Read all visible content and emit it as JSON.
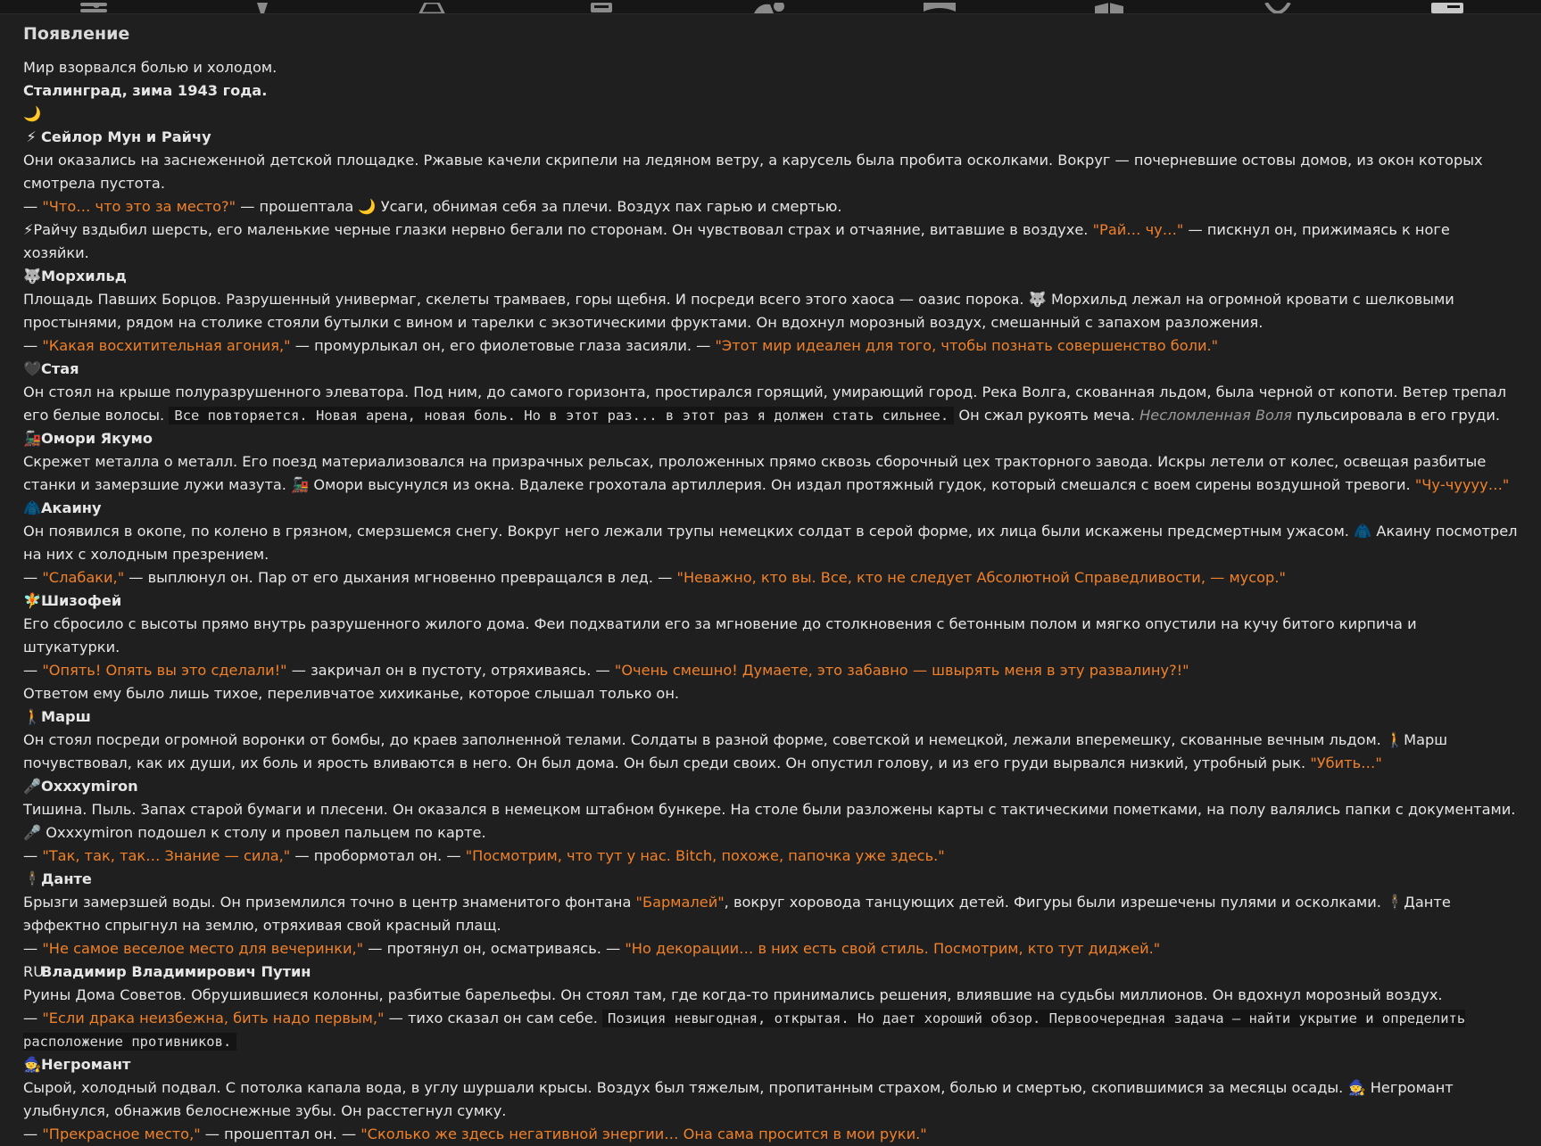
{
  "topbar": {
    "tabs": [
      {
        "icon": "sliders-icon"
      },
      {
        "icon": "pin-icon"
      },
      {
        "icon": "font-icon"
      },
      {
        "icon": "book-icon"
      },
      {
        "icon": "user-gear-icon"
      },
      {
        "icon": "avatar-frame-icon"
      },
      {
        "icon": "cube-icon"
      },
      {
        "icon": "smile-icon"
      },
      {
        "icon": "id-card-icon"
      }
    ]
  },
  "section_title": "Появление",
  "lines": [
    {
      "type": "text",
      "parts": [
        {
          "t": "Мир взорвался болью и холодом."
        }
      ]
    },
    {
      "type": "text",
      "parts": [
        {
          "t": "Сталинград, зима 1943 года.",
          "s": "bold"
        }
      ]
    },
    {
      "type": "header",
      "parts": [
        {
          "t": "🌙⚡",
          "s": "icon"
        },
        {
          "t": "Сейлор Мун и Райчу",
          "s": "name"
        }
      ]
    },
    {
      "type": "text",
      "parts": [
        {
          "t": "Они оказались на заснеженной детской площадке. Ржавые качели скрипели на ледяном ветру, а карусель была пробита осколками. Вокруг — почерневшие остовы домов, из окон которых смотрела пустота."
        }
      ]
    },
    {
      "type": "text",
      "parts": [
        {
          "t": "— "
        },
        {
          "t": "\"Что… что это за место?\"",
          "s": "q"
        },
        {
          "t": " — прошептала 🌙 Усаги, обнимая себя за плечи. Воздух пах гарью и смертью."
        }
      ]
    },
    {
      "type": "text",
      "parts": [
        {
          "t": "⚡Райчу вздыбил шерсть, его маленькие черные глазки нервно бегали по сторонам. Он чувствовал страх и отчаяние, витавшие в воздухе. "
        },
        {
          "t": "\"Рай… чу…\"",
          "s": "q"
        },
        {
          "t": " — пискнул он, прижимаясь к ноге хозяйки."
        }
      ]
    },
    {
      "type": "header",
      "parts": [
        {
          "t": "🐺",
          "s": "icon"
        },
        {
          "t": "Морхильд",
          "s": "name"
        }
      ]
    },
    {
      "type": "text",
      "parts": [
        {
          "t": "Площадь Павших Борцов. Разрушенный универмаг, скелеты трамваев, горы щебня. И посреди всего этого хаоса — оазис порока. 🐺 Морхильд лежал на огромной кровати с шелковыми простынями, рядом на столике стояли бутылки с вином и тарелки с экзотическими фруктами. Он вдохнул морозный воздух, смешанный с запахом разложения."
        }
      ]
    },
    {
      "type": "text",
      "parts": [
        {
          "t": "— "
        },
        {
          "t": "\"Какая восхитительная агония,\"",
          "s": "q"
        },
        {
          "t": " — промурлыкал он, его фиолетовые глаза засияли. — "
        },
        {
          "t": "\"Этот мир идеален для того, чтобы познать совершенство боли.\"",
          "s": "q"
        }
      ]
    },
    {
      "type": "header",
      "parts": [
        {
          "t": "🖤",
          "s": "icon"
        },
        {
          "t": "Стая",
          "s": "name"
        }
      ]
    },
    {
      "type": "text",
      "parts": [
        {
          "t": "Он стоял на крыше полуразрушенного элеватора. Под ним, до самого горизонта, простирался горящий, умирающий город. Река Волга, скованная льдом, была черной от копоти. Ветер трепал его белые волосы. "
        },
        {
          "t": "Все повторяется. Новая арена, новая боль. Но в этот раз... в этот раз я должен стать сильнее.",
          "s": "code"
        },
        {
          "t": " Он сжал рукоять меча. "
        },
        {
          "t": "Несломленная Воля",
          "s": "em"
        },
        {
          "t": " пульсировала в его груди."
        }
      ]
    },
    {
      "type": "header",
      "parts": [
        {
          "t": "🚂",
          "s": "icon"
        },
        {
          "t": "Омори Якумо",
          "s": "name"
        }
      ]
    },
    {
      "type": "text",
      "parts": [
        {
          "t": "Скрежет металла о металл. Его поезд материализовался на призрачных рельсах, проложенных прямо сквозь сборочный цех тракторного завода. Искры летели от колес, освещая разбитые станки и замерзшие лужи мазута. 🚂 Омори высунулся из окна. Вдалеке грохотала артиллерия. Он издал протяжный гудок, который смешался с воем сирены воздушной тревоги. "
        },
        {
          "t": "\"Чу-чуууу…\"",
          "s": "q"
        }
      ]
    },
    {
      "type": "header",
      "parts": [
        {
          "t": "🧥",
          "s": "icon"
        },
        {
          "t": "Акаину",
          "s": "name"
        }
      ]
    },
    {
      "type": "text",
      "parts": [
        {
          "t": "Он появился в окопе, по колено в грязном, смерзшемся снегу. Вокруг него лежали трупы немецких солдат в серой форме, их лица были искажены предсмертным ужасом. 🧥 Акаину посмотрел на них с холодным презрением."
        }
      ]
    },
    {
      "type": "text",
      "parts": [
        {
          "t": "— "
        },
        {
          "t": "\"Слабаки,\"",
          "s": "q"
        },
        {
          "t": " — выплюнул он. Пар от его дыхания мгновенно превращался в лед. — "
        },
        {
          "t": "\"Неважно, кто вы. Все, кто не следует Абсолютной Справедливости, — мусор.\"",
          "s": "q"
        }
      ]
    },
    {
      "type": "header",
      "parts": [
        {
          "t": "🧚",
          "s": "icon"
        },
        {
          "t": "Шизофей",
          "s": "name"
        }
      ]
    },
    {
      "type": "text",
      "parts": [
        {
          "t": "Его сбросило с высоты прямо внутрь разрушенного жилого дома. Феи подхватили его за мгновение до столкновения с бетонным полом и мягко опустили на кучу битого кирпича и штукатурки."
        }
      ]
    },
    {
      "type": "text",
      "parts": [
        {
          "t": "— "
        },
        {
          "t": "\"Опять! Опять вы это сделали!\"",
          "s": "q"
        },
        {
          "t": " — закричал он в пустоту, отряхиваясь. — "
        },
        {
          "t": "\"Очень смешно! Думаете, это забавно — швырять меня в эту развалину?!\"",
          "s": "q"
        }
      ]
    },
    {
      "type": "text",
      "parts": [
        {
          "t": "Ответом ему было лишь тихое, переливчатое хихиканье, которое слышал только он."
        }
      ]
    },
    {
      "type": "header",
      "parts": [
        {
          "t": "🚶",
          "s": "icon"
        },
        {
          "t": "Марш",
          "s": "name"
        }
      ]
    },
    {
      "type": "text",
      "parts": [
        {
          "t": "Он стоял посреди огромной воронки от бомбы, до краев заполненной телами. Солдаты в разной форме, советской и немецкой, лежали вперемешку, скованные вечным льдом. 🚶Марш почувствовал, как их души, их боль и ярость вливаются в него. Он был дома. Он был среди своих. Он опустил голову, и из его груди вырвался низкий, утробный рык. "
        },
        {
          "t": "\"Убить…\"",
          "s": "q"
        }
      ]
    },
    {
      "type": "header",
      "parts": [
        {
          "t": "🎤",
          "s": "icon"
        },
        {
          "t": "Oxxxymiron",
          "s": "name"
        }
      ]
    },
    {
      "type": "text",
      "parts": [
        {
          "t": "Тишина. Пыль. Запах старой бумаги и плесени. Он оказался в немецком штабном бункере. На столе были разложены карты с тактическими пометками, на полу валялись папки с документами. 🎤 Oxxxymiron подошел к столу и провел пальцем по карте."
        }
      ]
    },
    {
      "type": "text",
      "parts": [
        {
          "t": "— "
        },
        {
          "t": "\"Так, так, так… Знание — сила,\"",
          "s": "q"
        },
        {
          "t": " — пробормотал он. — "
        },
        {
          "t": "\"Посмотрим, что тут у нас. Bitch, похоже, папочка уже здесь.\"",
          "s": "q"
        }
      ]
    },
    {
      "type": "header",
      "parts": [
        {
          "t": "🕴",
          "s": "icon"
        },
        {
          "t": "Данте",
          "s": "name"
        }
      ]
    },
    {
      "type": "text",
      "parts": [
        {
          "t": "Брызги замерзшей воды. Он приземлился точно в центр знаменитого фонтана "
        },
        {
          "t": "\"Бармалей\"",
          "s": "q"
        },
        {
          "t": ", вокруг хоровода танцующих детей. Фигуры были изрешечены пулями и осколками. 🕴Данте эффектно спрыгнул на землю, отряхивая свой красный плащ."
        }
      ]
    },
    {
      "type": "text",
      "parts": [
        {
          "t": "— "
        },
        {
          "t": "\"Не самое веселое место для вечеринки,\"",
          "s": "q"
        },
        {
          "t": " — протянул он, осматриваясь. — "
        },
        {
          "t": "\"Но декорации… в них есть свой стиль. Посмотрим, кто тут диджей.\"",
          "s": "q"
        }
      ]
    },
    {
      "type": "header",
      "parts": [
        {
          "t": "RU",
          "s": "icon"
        },
        {
          "t": "Владимир Владимирович Путин",
          "s": "name"
        }
      ]
    },
    {
      "type": "text",
      "parts": [
        {
          "t": "Руины Дома Советов. Обрушившиеся колонны, разбитые барельефы. Он стоял там, где когда-то принимались решения, влиявшие на судьбы миллионов. Он вдохнул морозный воздух."
        }
      ]
    },
    {
      "type": "text",
      "parts": [
        {
          "t": "— "
        },
        {
          "t": "\"Если драка неизбежна, бить надо первым,\"",
          "s": "q"
        },
        {
          "t": " — тихо сказал он сам себе. "
        },
        {
          "t": "Позиция невыгодная, открытая. Но дает хороший обзор. Первоочередная задача — найти укрытие и определить расположение противников.",
          "s": "code"
        }
      ]
    },
    {
      "type": "header",
      "parts": [
        {
          "t": "🧙",
          "s": "icon"
        },
        {
          "t": "Негромант",
          "s": "name"
        }
      ]
    },
    {
      "type": "text",
      "parts": [
        {
          "t": "Сырой, холодный подвал. С потолка капала вода, в углу шуршали крысы. Воздух был тяжелым, пропитанным страхом, болью и смертью, скопившимися за месяцы осады. 🧙 Негромант улыбнулся, обнажив белоснежные зубы. Он расстегнул сумку."
        }
      ]
    },
    {
      "type": "text",
      "parts": [
        {
          "t": "— "
        },
        {
          "t": "\"Прекрасное место,\"",
          "s": "q"
        },
        {
          "t": " — прошептал он. — "
        },
        {
          "t": "\"Сколько же здесь негативной энергии… Она сама просится в мои руки.\"",
          "s": "q"
        }
      ]
    }
  ],
  "colors": {
    "quote": "#f0812a",
    "bg": "#1f1f1f",
    "text": "#e6e6e6"
  }
}
